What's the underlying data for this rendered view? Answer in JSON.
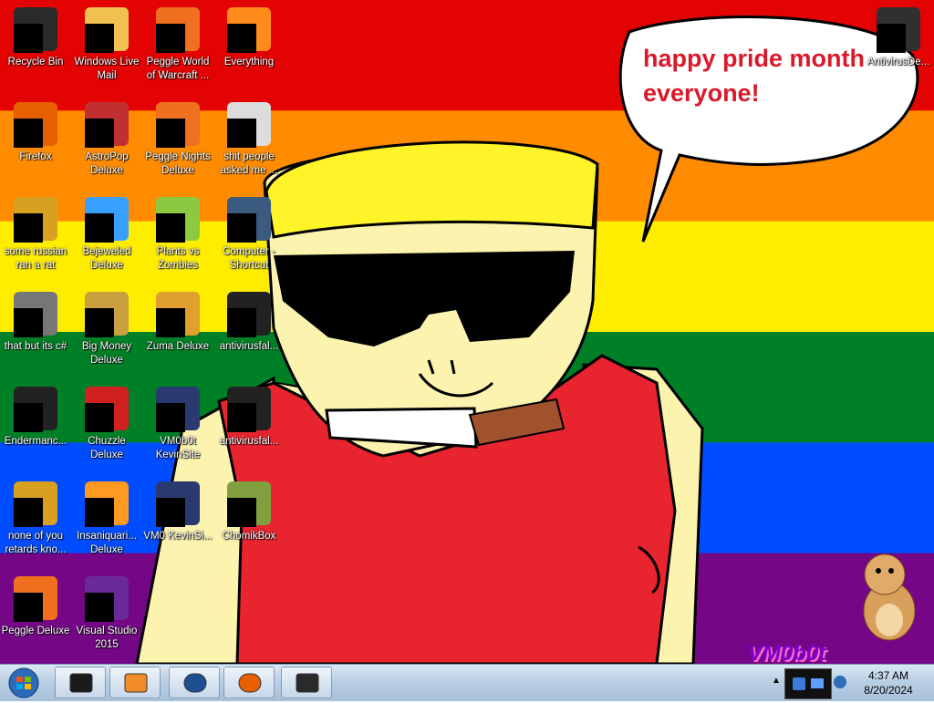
{
  "wallpaper": {
    "stripe_colors": [
      "#e40303",
      "#ff8c00",
      "#ffed00",
      "#008026",
      "#004dff",
      "#750787"
    ],
    "speech_bubble": "happy pride month everyone!",
    "watermark": "VM0b0t"
  },
  "icons": [
    {
      "label": "Recycle Bin",
      "icon": "recycle-bin-icon"
    },
    {
      "label": "Windows Live Mail",
      "icon": "mail-icon"
    },
    {
      "label": "Peggle World of Warcraft ...",
      "icon": "peggle-icon"
    },
    {
      "label": "Everything",
      "icon": "search-icon"
    },
    {
      "label": "Firefox",
      "icon": "firefox-icon"
    },
    {
      "label": "AstroPop Deluxe",
      "icon": "game-icon"
    },
    {
      "label": "Peggle Nights Deluxe",
      "icon": "peggle-icon"
    },
    {
      "label": "shit people asked me ...",
      "icon": "folder-icon"
    },
    {
      "label": "some russian ran a rat",
      "icon": "app-icon"
    },
    {
      "label": "Bejeweled Deluxe",
      "icon": "gem-icon"
    },
    {
      "label": "Plants vs Zombies",
      "icon": "plant-icon"
    },
    {
      "label": "Computer - Shortcut",
      "icon": "computer-icon"
    },
    {
      "label": "that but its c#",
      "icon": "window-stack-icon"
    },
    {
      "label": "Big Money Deluxe",
      "icon": "money-bag-icon"
    },
    {
      "label": "Zuma Deluxe",
      "icon": "zuma-icon"
    },
    {
      "label": "antivirusfal...",
      "icon": "console-icon"
    },
    {
      "label": "Endermanc...",
      "icon": "console-icon"
    },
    {
      "label": "Chuzzle Deluxe",
      "icon": "chuzzle-icon"
    },
    {
      "label": "VM0b0t KevinSite",
      "icon": "website-icon"
    },
    {
      "label": "antivirusfal...",
      "icon": "console-icon"
    },
    {
      "label": "none of you retards kno...",
      "icon": "app-icon"
    },
    {
      "label": "Insaniquari... Deluxe",
      "icon": "fish-icon"
    },
    {
      "label": "VM0 KevinSi...",
      "icon": "website-icon"
    },
    {
      "label": "ChomikBox",
      "icon": "hamster-icon"
    },
    {
      "label": "Peggle Deluxe",
      "icon": "peggle-icon"
    },
    {
      "label": "Visual Studio 2015",
      "icon": "visual-studio-icon"
    },
    {
      "label": "AntivirusDe...",
      "icon": "antivirus-icon"
    }
  ],
  "taskbar": {
    "pinned": [
      "console-icon",
      "media-player-icon",
      "globe-icon",
      "firefox-icon",
      "monitor-icon"
    ],
    "clock_time": "4:37 AM",
    "clock_date": "8/20/2024"
  }
}
